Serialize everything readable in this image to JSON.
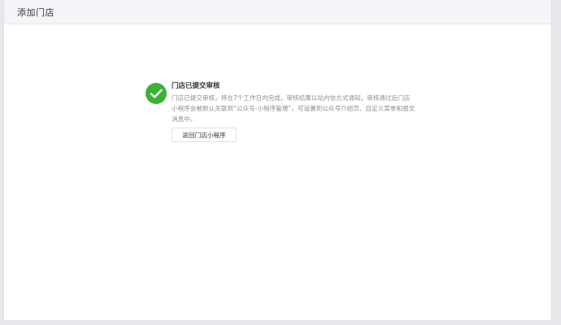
{
  "header": {
    "title": "添加门店"
  },
  "result": {
    "icon": "success-check-icon",
    "icon_color": "#3bb234",
    "title": "门店已提交审核",
    "description": "门店已提交审核，将在7个工作日内完成，审核结果以站内信方式通知。审核通过后门店小程序会被默认关联到“公众号-小程序管理”，可设置到公众号介绍页、自定义菜单和图文消息中。",
    "back_button_label": "返回门店小程序"
  }
}
